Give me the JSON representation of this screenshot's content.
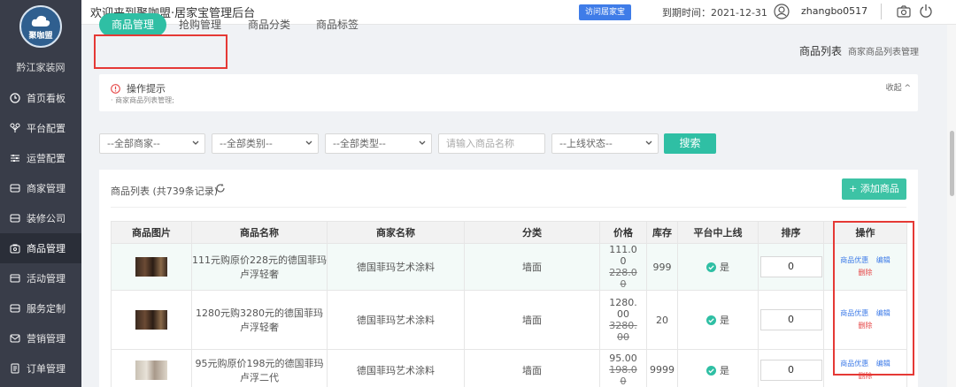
{
  "brand": {
    "logo_text": "聚咖盟",
    "shop_name": "黔江家装网"
  },
  "sidebar": {
    "items": [
      {
        "label": "首页看板",
        "icon": "clock-icon"
      },
      {
        "label": "平台配置",
        "icon": "nodes-icon"
      },
      {
        "label": "运营配置",
        "icon": "sliders-icon"
      },
      {
        "label": "商家管理",
        "icon": "folder-icon"
      },
      {
        "label": "装修公司",
        "icon": "folder-icon"
      },
      {
        "label": "商品管理",
        "icon": "bag-icon",
        "active": true
      },
      {
        "label": "活动管理",
        "icon": "card-icon"
      },
      {
        "label": "服务定制",
        "icon": "folder-icon"
      },
      {
        "label": "营销管理",
        "icon": "mail-icon"
      },
      {
        "label": "订单管理",
        "icon": "doc-icon"
      }
    ]
  },
  "topbar": {
    "welcome": "欢迎来到聚咖盟·居家宝管理后台",
    "visit_button": "访问居家宝",
    "expire": "到期时间：2021-12-31",
    "username": "zhangbo0517"
  },
  "tabs": [
    "商品管理",
    "抢购管理",
    "商品分类",
    "商品标签"
  ],
  "breadcrumb": {
    "main": "商品列表",
    "sub": "商家商品列表管理"
  },
  "tip": {
    "title": "操作提示",
    "desc": "· 商家商品列表管理;",
    "collapse": "收起 ^"
  },
  "filters": {
    "merchant": "--全部商家--",
    "category": "--全部类别--",
    "type": "--全部类型--",
    "name_placeholder": "请输入商品名称",
    "status": "--上线状态--",
    "search_label": "搜索"
  },
  "list": {
    "title": "商品列表 (共739条记录)",
    "add_button": "+ 添加商品",
    "columns": [
      "商品图片",
      "商品名称",
      "商家名称",
      "分类",
      "价格",
      "库存",
      "平台中上线",
      "排序",
      "操作"
    ],
    "rows": [
      {
        "name": "111元购原价228元的德国菲玛卢浮轻奢",
        "merchant": "德国菲玛艺术涂料",
        "category": "墙面",
        "price": "111.00",
        "old_price": "228.00",
        "stock": "999",
        "online": "是",
        "sort": "0"
      },
      {
        "name": "1280元购3280元的德国菲玛卢浮轻奢",
        "merchant": "德国菲玛艺术涂料",
        "category": "墙面",
        "price": "1280.00",
        "old_price": "3280.00",
        "stock": "20",
        "online": "是",
        "sort": "0"
      },
      {
        "name": "95元购原价198元的德国菲玛卢浮二代",
        "merchant": "德国菲玛艺术涂料",
        "category": "墙面",
        "price": "95.00",
        "old_price": "198.00",
        "stock": "9999",
        "online": "是",
        "sort": "0"
      }
    ],
    "ops": {
      "discount": "商品优惠",
      "edit": "编辑",
      "delete": "删除"
    }
  },
  "colors": {
    "primary": "#2fbfa4",
    "sidebar": "#393d49",
    "link": "#3f7ce8",
    "danger": "#e54545",
    "highlight_box": "#e53935"
  }
}
